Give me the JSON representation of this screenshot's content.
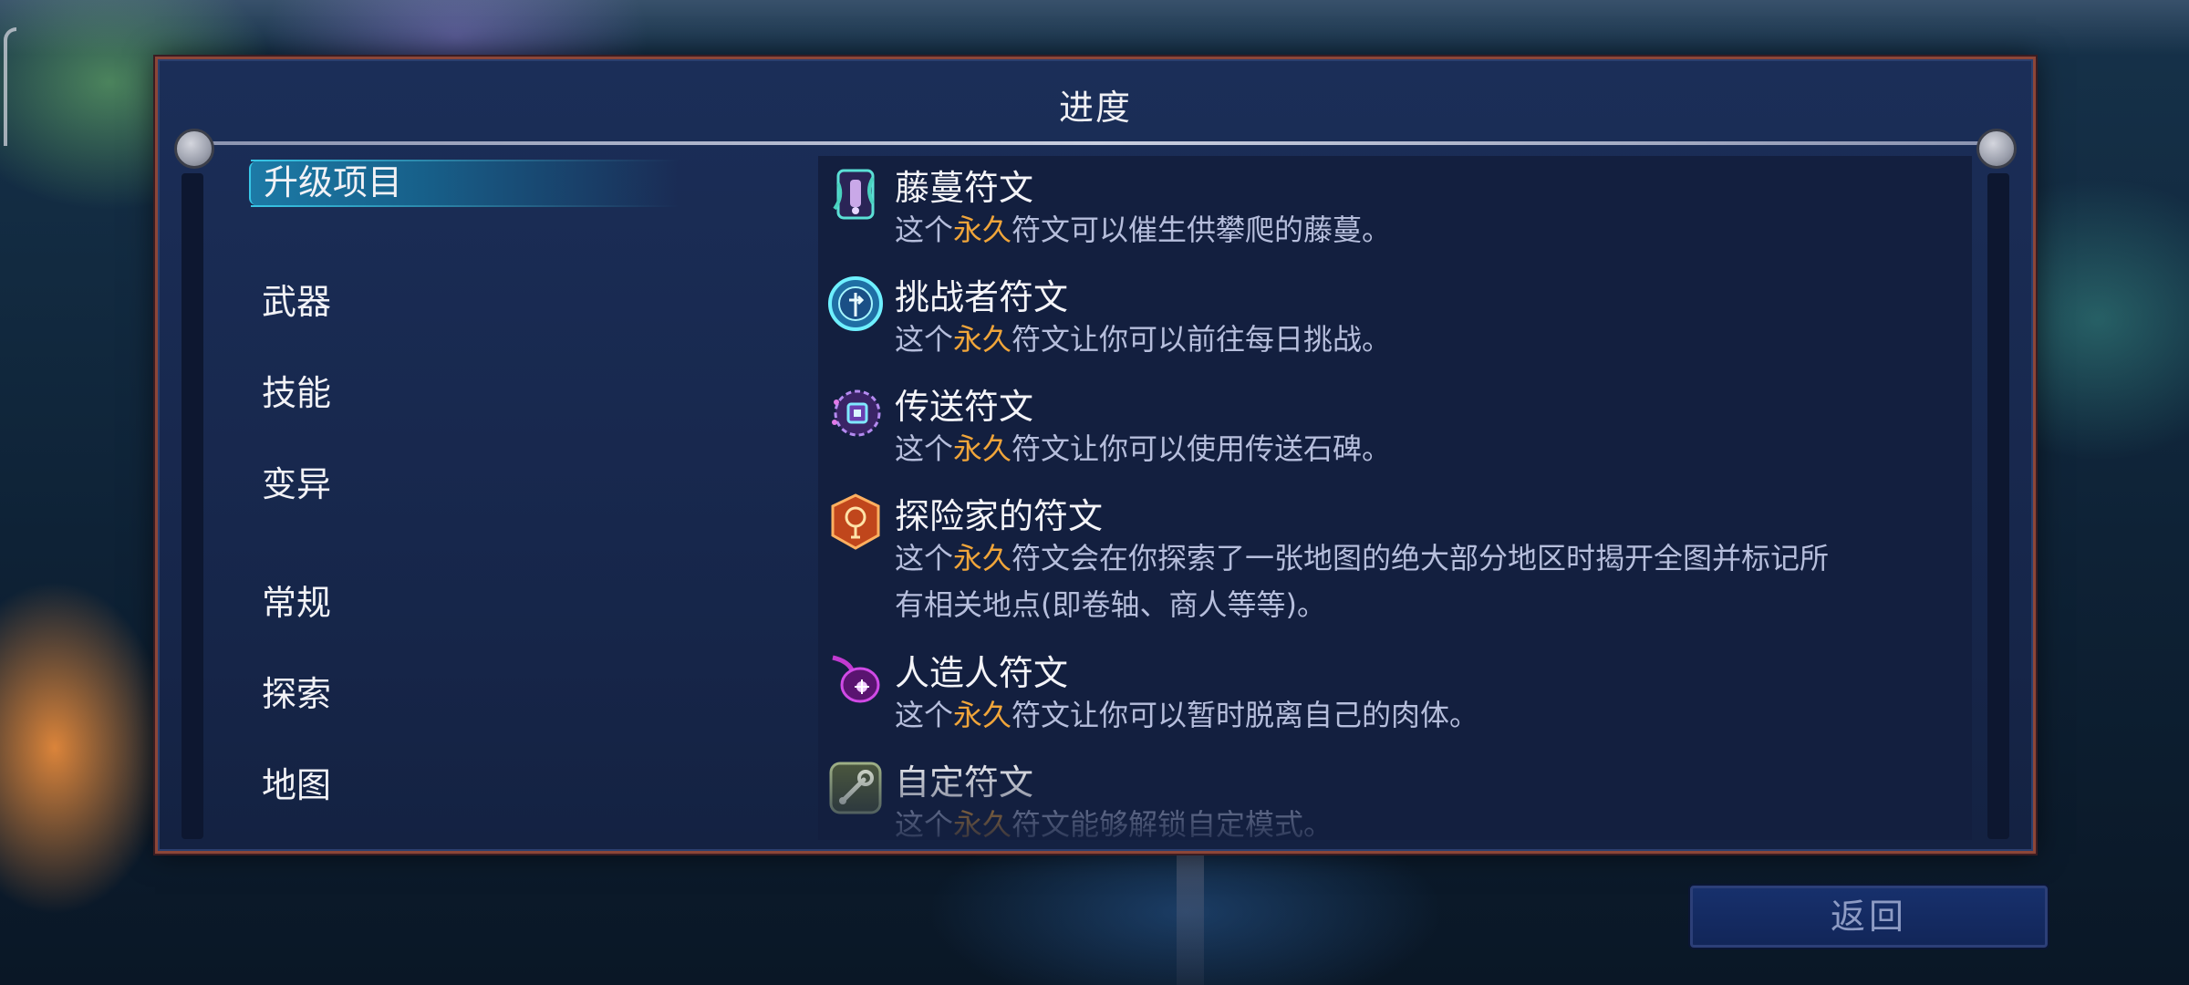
{
  "panel": {
    "title": "进度"
  },
  "categories": [
    {
      "label": "升级项目",
      "selected": true
    },
    {
      "label": "武器"
    },
    {
      "label": "技能"
    },
    {
      "label": "变异"
    },
    {
      "label": "常规"
    },
    {
      "label": "探索"
    },
    {
      "label": "地图"
    }
  ],
  "entries": [
    {
      "icon": "vine-rune-icon",
      "title": "藤蔓符文",
      "desc_prefix": "这个",
      "desc_highlight": "永久",
      "desc_suffix": "符文可以催生供攀爬的藤蔓。"
    },
    {
      "icon": "challenger-rune-icon",
      "title": "挑战者符文",
      "desc_prefix": "这个",
      "desc_highlight": "永久",
      "desc_suffix": "符文让你可以前往每日挑战。"
    },
    {
      "icon": "teleport-rune-icon",
      "title": "传送符文",
      "desc_prefix": "这个",
      "desc_highlight": "永久",
      "desc_suffix": "符文让你可以使用传送石碑。"
    },
    {
      "icon": "explorer-rune-icon",
      "title": "探险家的符文",
      "desc_prefix": "这个",
      "desc_highlight": "永久",
      "desc_suffix": "符文会在你探索了一张地图的绝大部分地区时揭开全图并标记所有相关地点(即卷轴、商人等等)。"
    },
    {
      "icon": "homunculus-rune-icon",
      "title": "人造人符文",
      "desc_prefix": "这个",
      "desc_highlight": "永久",
      "desc_suffix": "符文让你可以暂时脱离自己的肉体。"
    },
    {
      "icon": "custom-rune-icon",
      "title": "自定符文",
      "desc_prefix": "这个",
      "desc_highlight": "永久",
      "desc_suffix": "符文能够解锁自定模式。"
    }
  ],
  "back_button": {
    "label": "返回"
  },
  "colors": {
    "highlight": "#f0a53a",
    "selection": "#38c6e6",
    "frame": "#8c4638"
  }
}
